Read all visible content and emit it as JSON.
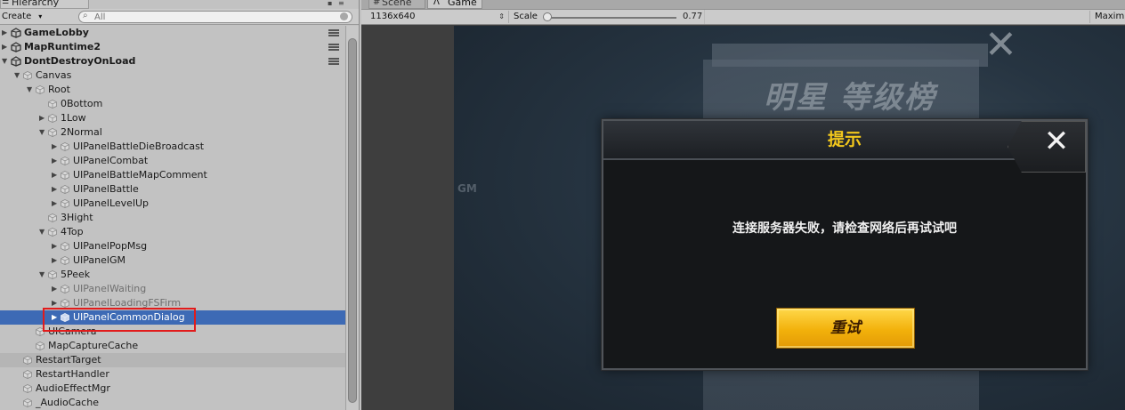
{
  "hierarchy": {
    "tab_label": "Hierarchy",
    "create_label": "Create",
    "search_placeholder": "All",
    "rows": [
      {
        "label": "GameLobby",
        "depth": 0,
        "type": "scene",
        "expanded": false
      },
      {
        "label": "MapRuntime2",
        "depth": 0,
        "type": "scene",
        "expanded": false
      },
      {
        "label": "DontDestroyOnLoad",
        "depth": 0,
        "type": "scene",
        "expanded": true
      },
      {
        "label": "Canvas",
        "depth": 1,
        "type": "object",
        "expanded": true
      },
      {
        "label": "Root",
        "depth": 2,
        "type": "object",
        "expanded": true
      },
      {
        "label": "0Bottom",
        "depth": 3,
        "type": "object",
        "expanded": null
      },
      {
        "label": "1Low",
        "depth": 3,
        "type": "object",
        "expanded": false
      },
      {
        "label": "2Normal",
        "depth": 3,
        "type": "object",
        "expanded": true
      },
      {
        "label": "UIPanelBattleDieBroadcast",
        "depth": 4,
        "type": "object",
        "expanded": false
      },
      {
        "label": "UIPanelCombat",
        "depth": 4,
        "type": "object",
        "expanded": false
      },
      {
        "label": "UIPanelBattleMapComment",
        "depth": 4,
        "type": "object",
        "expanded": false
      },
      {
        "label": "UIPanelBattle",
        "depth": 4,
        "type": "object",
        "expanded": false
      },
      {
        "label": "UIPanelLevelUp",
        "depth": 4,
        "type": "object",
        "expanded": false
      },
      {
        "label": "3Hight",
        "depth": 3,
        "type": "object",
        "expanded": null
      },
      {
        "label": "4Top",
        "depth": 3,
        "type": "object",
        "expanded": true
      },
      {
        "label": "UIPanelPopMsg",
        "depth": 4,
        "type": "object",
        "expanded": false
      },
      {
        "label": "UIPanelGM",
        "depth": 4,
        "type": "object",
        "expanded": false
      },
      {
        "label": "5Peek",
        "depth": 3,
        "type": "object",
        "expanded": true
      },
      {
        "label": "UIPanelWaiting",
        "depth": 4,
        "type": "object",
        "expanded": false,
        "dim": true
      },
      {
        "label": "UIPanelLoadingFSFirm",
        "depth": 4,
        "type": "object",
        "expanded": false,
        "dim": true
      },
      {
        "label": "UIPanelCommonDialog",
        "depth": 4,
        "type": "object",
        "expanded": false,
        "selected": true
      },
      {
        "label": "UICamera",
        "depth": 2,
        "type": "object",
        "expanded": null
      },
      {
        "label": "MapCaptureCache",
        "depth": 2,
        "type": "object",
        "expanded": null
      },
      {
        "label": "RestartTarget",
        "depth": 1,
        "type": "object",
        "expanded": null,
        "highlight": true
      },
      {
        "label": "RestartHandler",
        "depth": 1,
        "type": "object",
        "expanded": null
      },
      {
        "label": "AudioEffectMgr",
        "depth": 1,
        "type": "object",
        "expanded": null
      },
      {
        "label": "_AudioCache",
        "depth": 1,
        "type": "object",
        "expanded": null
      }
    ]
  },
  "game_view": {
    "scene_tab_label": "Scene",
    "game_tab_label": "Game",
    "resolution": "1136x640",
    "scale_label": "Scale",
    "scale_value": "0.77",
    "maximize_label": "Maxim",
    "background_title": "明星 等级榜",
    "background_gm": "GM"
  },
  "dialog": {
    "title": "提示",
    "message": "连接服务器失败，请检查网络后再试试吧",
    "retry_label": "重试"
  },
  "colors": {
    "selection": "#3d6ab5",
    "annotation_box": "#e21b1b",
    "dialog_title": "#f3c81c",
    "retry_button": "#f2b10b"
  },
  "icons": {
    "scene": "unity-logo-icon",
    "object": "cube-icon",
    "close": "close-icon",
    "search": "search-icon",
    "menu": "context-menu-icon"
  }
}
